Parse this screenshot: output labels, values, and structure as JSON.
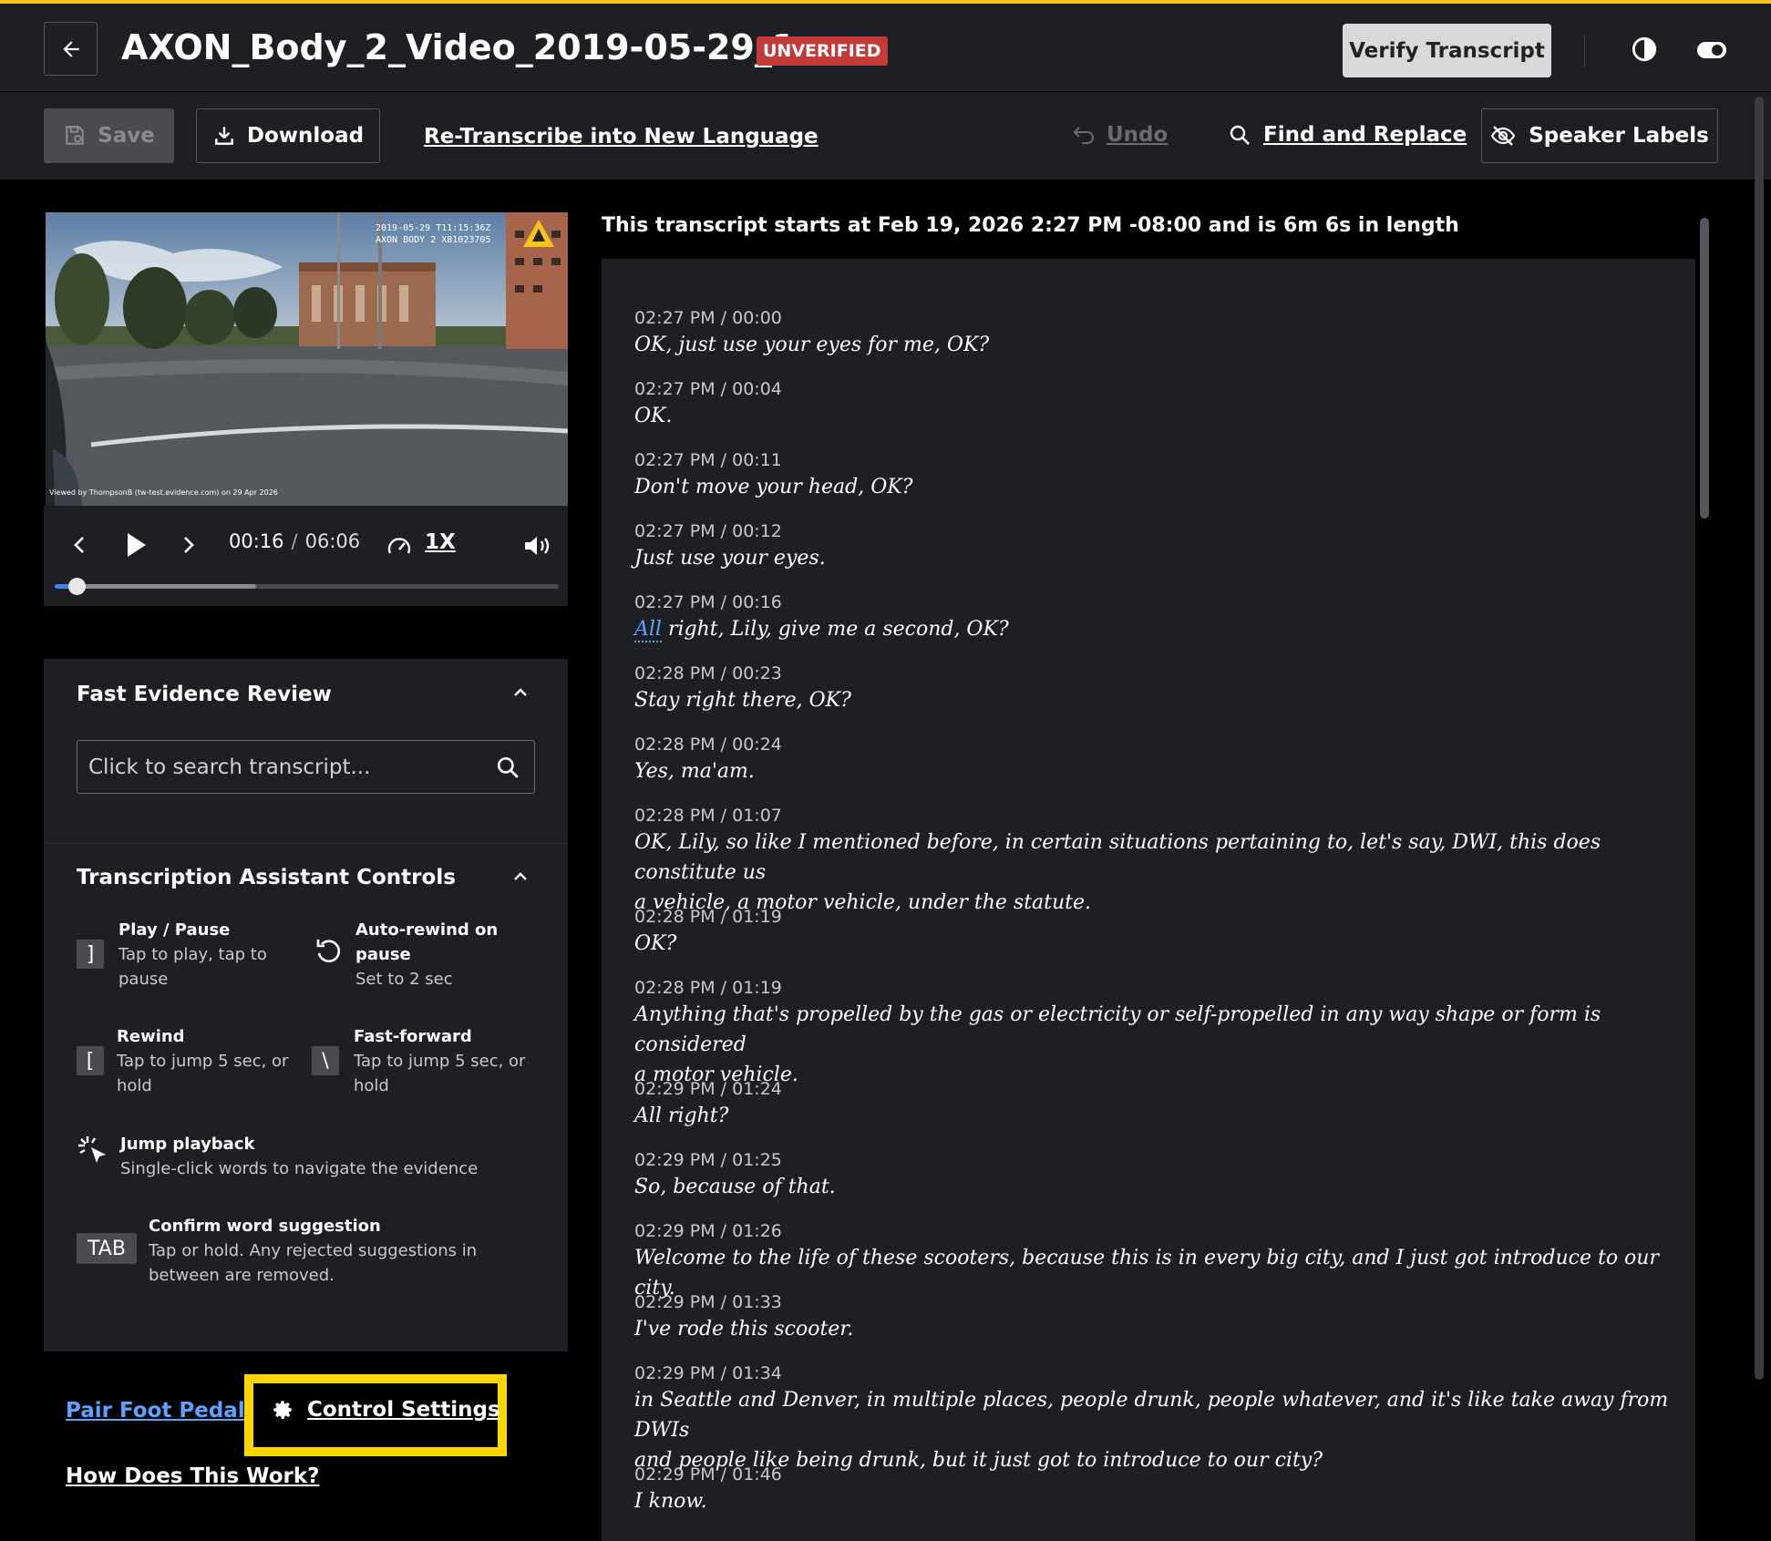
{
  "header": {
    "title": "AXON_Body_2_Video_2019-05-29_1...",
    "status_badge": "UNVERIFIED",
    "verify_label": "Verify Transcript",
    "accent_color": "#f5c518",
    "badge_color": "#c23a3a"
  },
  "toolbar": {
    "save_label": "Save",
    "download_label": "Download",
    "retranscribe_label": "Re-Transcribe into New Language",
    "undo_label": "Undo",
    "find_replace_label": "Find and Replace",
    "speaker_labels_label": "Speaker Labels"
  },
  "video": {
    "overlay_timestamp": "2019-05-29 T11:15:36Z",
    "overlay_device": "AXON BODY 2 X81023705",
    "watermark": "Viewed by ThompsonB (tw-test.evidence.com) on 29 Apr 2026"
  },
  "player": {
    "current_time": "00:16",
    "separator": "/",
    "duration": "06:06",
    "speed": "1X",
    "progress_fraction": 0.044,
    "buffered_fraction": 0.4
  },
  "fast_review": {
    "title": "Fast Evidence Review",
    "search_placeholder": "Click to search transcript..."
  },
  "assistant": {
    "title": "Transcription Assistant Controls",
    "controls": [
      {
        "key": "]",
        "title": "Play / Pause",
        "desc1": "Tap to play, tap to",
        "desc2": "pause"
      },
      {
        "key": "",
        "title1": "Auto-rewind on",
        "title2": "pause",
        "desc1": "Set to 2 sec"
      },
      {
        "key": "[",
        "title": "Rewind",
        "desc1": "Tap to jump 5 sec, or",
        "desc2": "hold"
      },
      {
        "key": "\\",
        "title": "Fast-forward",
        "desc1": "Tap to jump 5 sec, or",
        "desc2": "hold"
      },
      {
        "key": "",
        "title": "Jump playback",
        "desc1": "Single-click words to navigate the evidence"
      },
      {
        "key": "TAB",
        "title": "Confirm word suggestion",
        "desc1": "Tap or hold. Any rejected suggestions in",
        "desc2": "between are removed."
      }
    ]
  },
  "links": {
    "pair_foot_pedal": "Pair Foot Pedal",
    "control_settings": "Control Settings",
    "how_does_this_work": "How Does This Work?"
  },
  "transcript": {
    "header": "This transcript starts at Feb 19, 2026 2:27 PM -08:00 and is 6m 6s in length",
    "segments": [
      {
        "time": "02:27 PM / 00:00",
        "text": "OK, just use your eyes for me, OK?"
      },
      {
        "time": "02:27 PM / 00:04",
        "text": "OK."
      },
      {
        "time": "02:27 PM / 00:11",
        "text": "Don't move your head, OK?"
      },
      {
        "time": "02:27 PM / 00:12",
        "text": "Just use your eyes."
      },
      {
        "time": "02:27 PM / 00:16",
        "highlight": "All",
        "text": " right, Lily, give me a second, OK?"
      },
      {
        "time": "02:28 PM / 00:23",
        "text": "Stay right there, OK?"
      },
      {
        "time": "02:28 PM / 00:24",
        "text": "Yes, ma'am."
      },
      {
        "time": "02:28 PM / 01:07",
        "text": "OK, Lily, so like I mentioned before, in certain situations pertaining to, let's say, DWI, this does constitute us",
        "text2": "a vehicle, a motor vehicle, under the statute."
      },
      {
        "time": "02:28 PM / 01:19",
        "text": "OK?"
      },
      {
        "time": "02:28 PM / 01:19",
        "text": "Anything that's propelled by the gas or electricity or self-propelled in any way shape or form is considered",
        "text2": "a motor vehicle."
      },
      {
        "time": "02:29 PM / 01:24",
        "text": "All right?"
      },
      {
        "time": "02:29 PM / 01:25",
        "text": "So, because of that."
      },
      {
        "time": "02:29 PM / 01:26",
        "text": "Welcome to the life of these scooters, because this is in every big city, and I just got introduce to our city."
      },
      {
        "time": "02:29 PM / 01:33",
        "text": "I've rode this scooter."
      },
      {
        "time": "02:29 PM / 01:34",
        "text": "in Seattle and Denver, in multiple places, people drunk, people whatever, and it's like take away from DWIs",
        "text2": "and people like being drunk, but it just got to introduce to our city?"
      },
      {
        "time": "02:29 PM / 01:46",
        "text": "I know."
      }
    ]
  }
}
